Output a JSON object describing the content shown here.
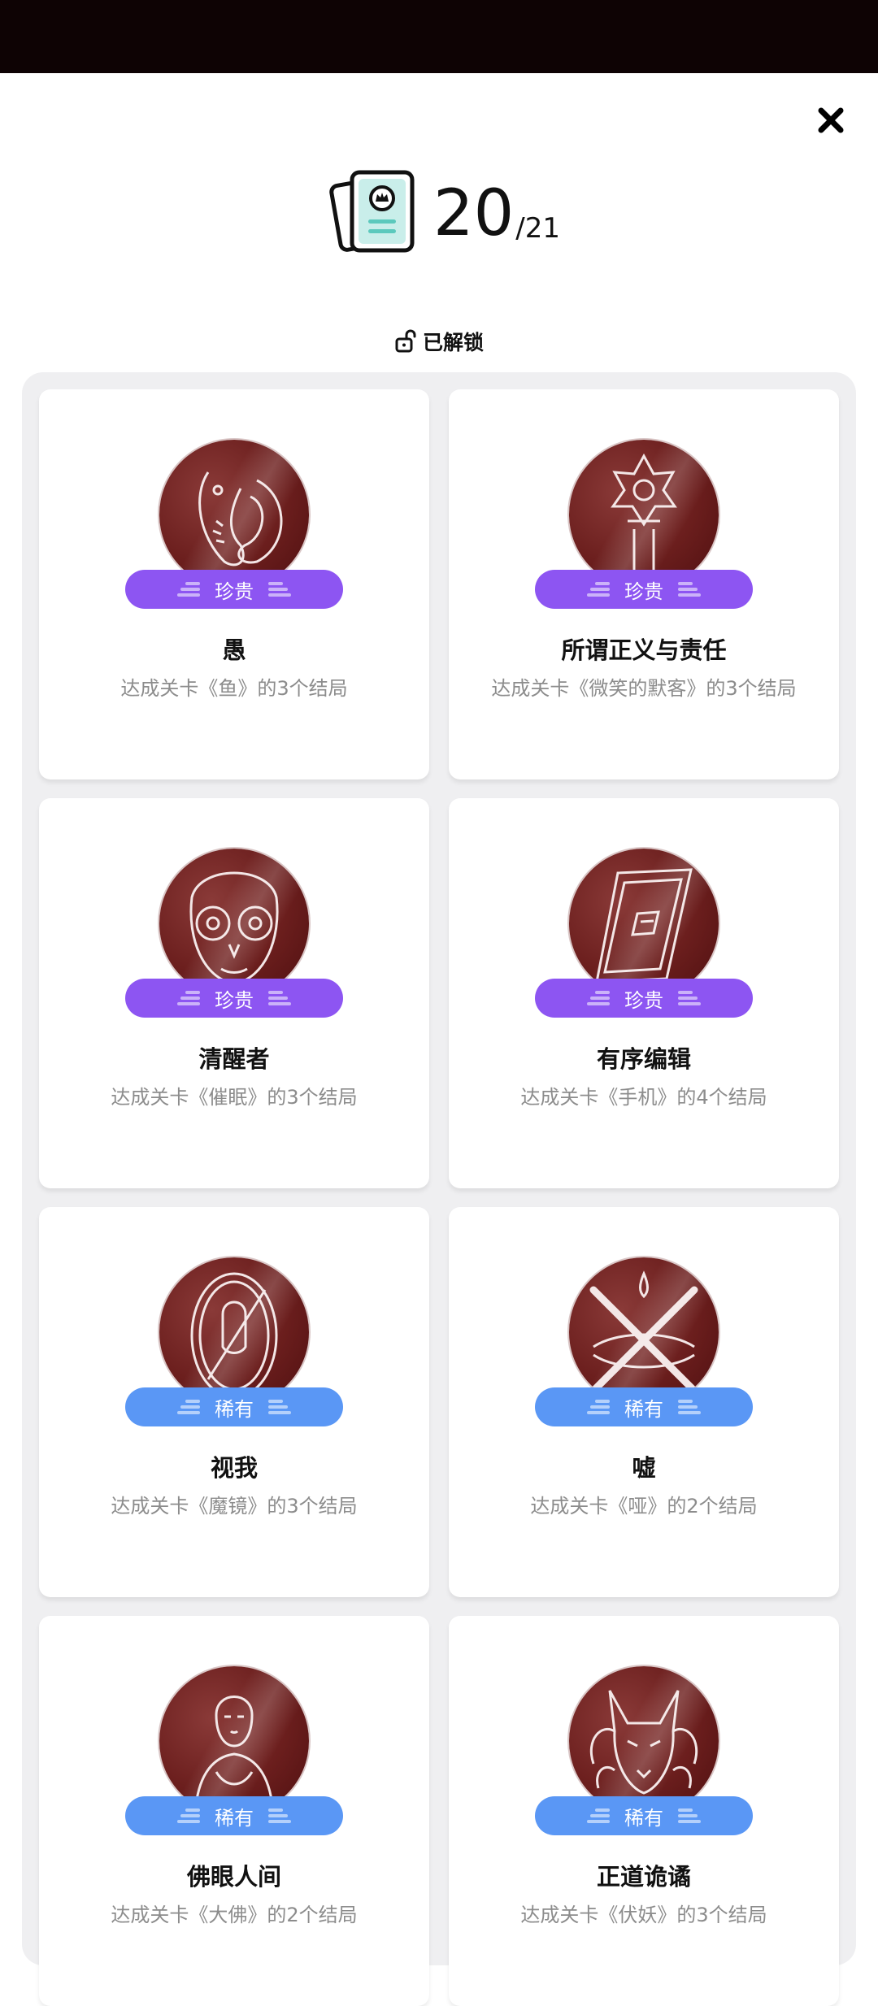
{
  "header": {
    "close_icon": "close-icon",
    "counter_icon": "card-stack-icon",
    "unlocked_count": "20",
    "total_count": "/21"
  },
  "filter": {
    "label": "已解锁",
    "icon": "unlock-icon"
  },
  "colors": {
    "precious_pill": "#8d55f2",
    "rare_pill": "#5a97f5",
    "medal_base": "#6b1e1d",
    "status_bar": "#0e0304"
  },
  "achievements": [
    {
      "title": "愚",
      "tier": "珍贵",
      "desc": "达成关卡《鱼》的3个结局",
      "icon": "koi-fish-icon"
    },
    {
      "title": "所谓正义与责任",
      "tier": "珍贵",
      "desc": "达成关卡《微笑的默客》的3个结局",
      "icon": "sheriff-star-icon"
    },
    {
      "title": "清醒者",
      "tier": "珍贵",
      "desc": "达成关卡《催眠》的3个结局",
      "icon": "wide-eyed-face-icon"
    },
    {
      "title": "有序编辑",
      "tier": "珍贵",
      "desc": "达成关卡《手机》的4个结局",
      "icon": "phone-icon"
    },
    {
      "title": "视我",
      "tier": "稀有",
      "desc": "达成关卡《魔镜》的3个结局",
      "icon": "mirror-icon"
    },
    {
      "title": "嘘",
      "tier": "稀有",
      "desc": "达成关卡《哑》的2个结局",
      "icon": "crossed-out-icon"
    },
    {
      "title": "佛眼人间",
      "tier": "稀有",
      "desc": "达成关卡《大佛》的2个结局",
      "icon": "buddha-icon"
    },
    {
      "title": "正道诡谲",
      "tier": "稀有",
      "desc": "达成关卡《伏妖》的3个结局",
      "icon": "fox-demon-icon"
    }
  ]
}
